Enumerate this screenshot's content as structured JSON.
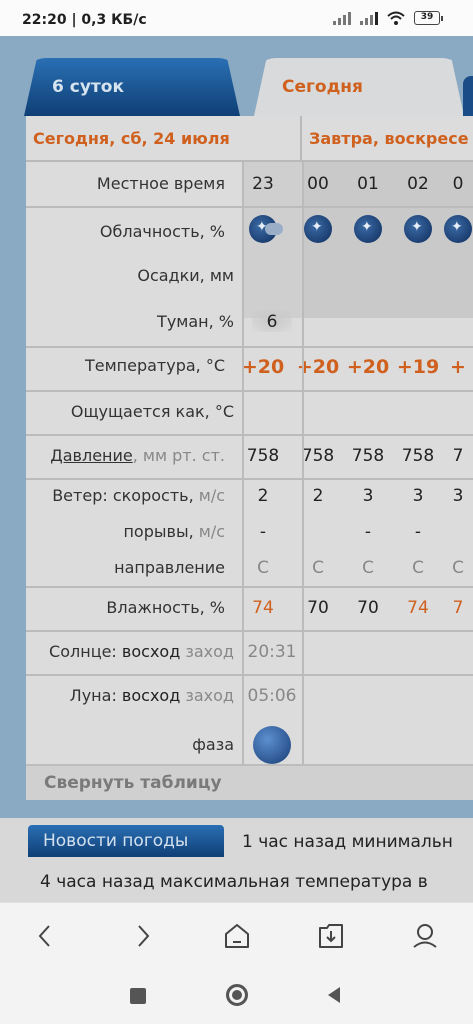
{
  "status_bar": {
    "time": "22:20 | 0,3 КБ/с",
    "battery": "39"
  },
  "tabs": {
    "six_days": "6 суток",
    "today": "Сегодня"
  },
  "days": {
    "today": "Сегодня, сб, 24 июля",
    "tomorrow": "Завтра, воскресе"
  },
  "table": {
    "local_time": {
      "label": "Местное время",
      "values": [
        "23",
        "00",
        "01",
        "02",
        "0"
      ]
    },
    "cloudiness": {
      "label": "Облачность, %"
    },
    "precipitation": {
      "label": "Осадки, мм"
    },
    "fog": {
      "label": "Туман, %",
      "value": "6"
    },
    "temperature": {
      "label": "Температура, °C",
      "values": [
        "+20",
        "+20",
        "+20",
        "+19",
        "+"
      ]
    },
    "feels_like": {
      "label": "Ощущается как, °C"
    },
    "pressure": {
      "label_link": "Давление",
      "label_unit": ", мм рт. ст.",
      "values": [
        "758",
        "758",
        "758",
        "758",
        "7"
      ]
    },
    "wind_speed": {
      "label": "Ветер: скорость,",
      "unit": " м/с",
      "values": [
        "2",
        "2",
        "3",
        "3",
        "3"
      ]
    },
    "gusts": {
      "label": "порывы,",
      "unit": " м/с",
      "values": [
        "-",
        "",
        "-",
        "-",
        ""
      ]
    },
    "direction": {
      "label": "направление",
      "values": [
        "С",
        "С",
        "С",
        "С",
        "С"
      ]
    },
    "humidity": {
      "label": "Влажность, %",
      "values": [
        "74",
        "70",
        "70",
        "74",
        "7"
      ]
    },
    "sun": {
      "label": "Солнце:",
      "rise": "восход",
      "set": "заход",
      "value": "20:31"
    },
    "moon": {
      "label": "Луна:",
      "rise": "восход",
      "set": "заход",
      "value": "05:06",
      "phase": "фаза"
    }
  },
  "collapse_label": "Свернуть таблицу",
  "news": {
    "tag": "Новости погоды",
    "item1": "1 час назад минимальн",
    "item2": "4 часа назад максимальная температура в"
  },
  "icons": {
    "back": "chevron-left-icon",
    "forward": "chevron-right-icon",
    "home": "home-icon",
    "downloads": "download-icon",
    "profile": "profile-icon"
  }
}
